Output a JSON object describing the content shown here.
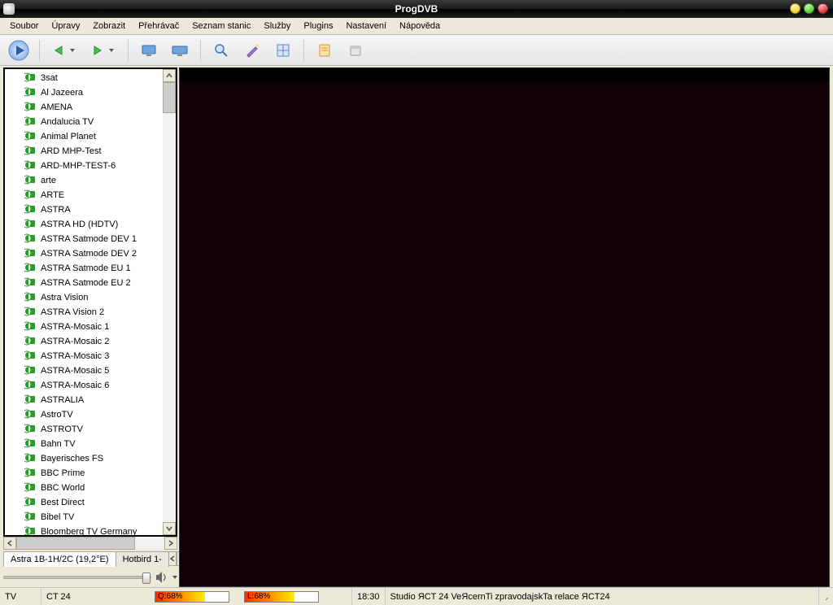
{
  "window": {
    "title": "ProgDVB"
  },
  "menu": [
    "Soubor",
    "Úpravy",
    "Zobrazit",
    "Přehrávač",
    "Seznam stanic",
    "Služby",
    "Plugins",
    "Nastavení",
    "Nápověda"
  ],
  "toolbar": {
    "icons": [
      "play",
      "back",
      "fwd",
      "display1",
      "display2",
      "search",
      "wizard",
      "grid",
      "notes",
      "box"
    ]
  },
  "channels": [
    "3sat",
    "Al Jazeera",
    "AMENA",
    "Andalucia TV",
    "Animal Planet",
    "ARD MHP-Test",
    "ARD-MHP-TEST-6",
    "arte",
    "ARTE",
    "ASTRA",
    "ASTRA HD (HDTV)",
    "ASTRA Satmode DEV 1",
    "ASTRA Satmode DEV 2",
    "ASTRA Satmode EU 1",
    "ASTRA Satmode EU 2",
    "Astra Vision",
    "ASTRA Vision 2",
    "ASTRA-Mosaic 1",
    "ASTRA-Mosaic 2",
    "ASTRA-Mosaic 3",
    "ASTRA-Mosaic 5",
    "ASTRA-Mosaic 6",
    "ASTRALIA",
    "AstroTV",
    "ASTROTV",
    "Bahn TV",
    "Bayerisches FS",
    "BBC Prime",
    "BBC World",
    "Best Direct",
    "Bibel TV",
    "Bloomberg TV Germany"
  ],
  "tabs": {
    "active": "Astra 1B-1H/2C (19,2°E)",
    "next": "Hotbird 1-"
  },
  "status": {
    "type": "TV",
    "channel": "CT 24",
    "q_label": "Q:68%",
    "l_label": "L:68%",
    "signal_q": 68,
    "signal_l": 68,
    "clock": "18:30",
    "epg": "Studio ЯCT 24 VeЯcernTi zpravodajskTa relace ЯCT24"
  }
}
